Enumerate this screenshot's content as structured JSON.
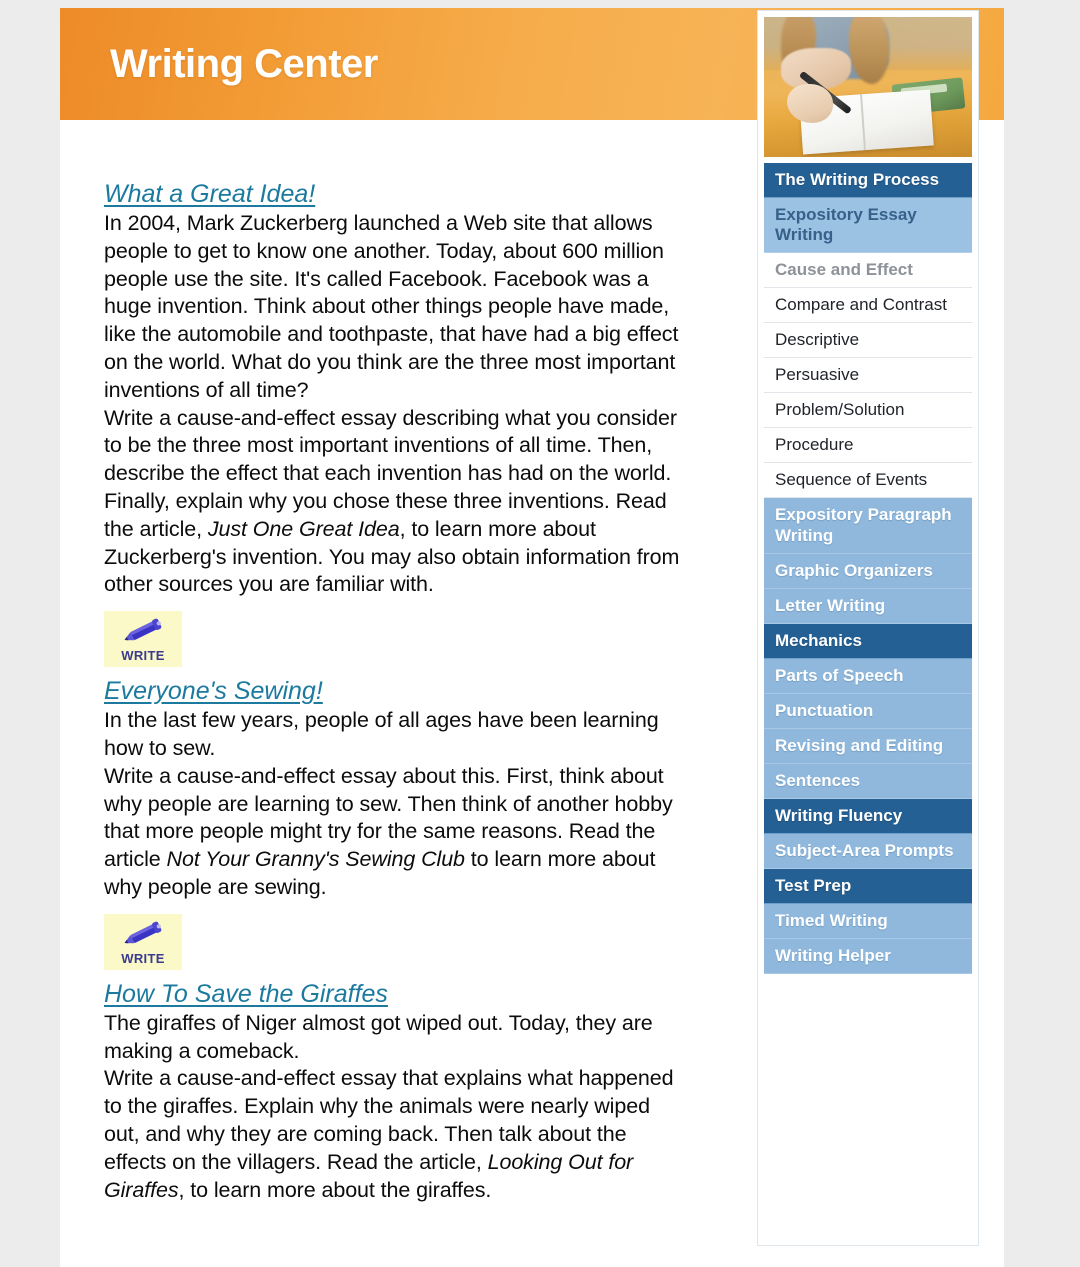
{
  "banner": {
    "title": "Writing Center"
  },
  "sidebar": {
    "photo_alt": "girl-writing-in-notebook-photo",
    "items": [
      {
        "label": "The Writing Process",
        "style": "dark"
      },
      {
        "label": "Expository Essay Writing",
        "style": "active-sub"
      },
      {
        "label": "Cause and Effect",
        "style": "current"
      },
      {
        "label": "Compare and Contrast",
        "style": "plain"
      },
      {
        "label": "Descriptive",
        "style": "plain"
      },
      {
        "label": "Persuasive",
        "style": "plain"
      },
      {
        "label": "Problem/Solution",
        "style": "plain"
      },
      {
        "label": "Procedure",
        "style": "plain"
      },
      {
        "label": "Sequence of Events",
        "style": "plain"
      },
      {
        "label": "Expository Paragraph Writing",
        "style": "light"
      },
      {
        "label": "Graphic Organizers",
        "style": "light"
      },
      {
        "label": "Letter Writing",
        "style": "light"
      },
      {
        "label": "Mechanics",
        "style": "dark"
      },
      {
        "label": "Parts of Speech",
        "style": "light"
      },
      {
        "label": "Punctuation",
        "style": "light"
      },
      {
        "label": "Revising and Editing",
        "style": "light"
      },
      {
        "label": "Sentences",
        "style": "light"
      },
      {
        "label": "Writing Fluency",
        "style": "dark"
      },
      {
        "label": "Subject-Area Prompts",
        "style": "light"
      },
      {
        "label": "Test Prep",
        "style": "dark"
      },
      {
        "label": "Timed Writing",
        "style": "light"
      },
      {
        "label": "Writing Helper",
        "style": "light"
      }
    ]
  },
  "main": {
    "entries": [
      {
        "title": "What a Great Idea!",
        "intro": "In 2004, Mark Zuckerberg launched a Web site that allows people to get to know one another. Today, about 600 million people use the site. It's called Facebook. Facebook was a huge invention. Think about other things people have made, like the automobile and toothpaste, that have had a big effect on the world. What do you think are the three most important inventions of all time?",
        "prompt_pre": "Write a cause-and-effect essay describing what you consider to be the three most important inventions of all time. Then, describe the effect that each invention has had on the world. Finally, explain why you chose these three inventions. Read the article, ",
        "article": "Just One Great Idea",
        "prompt_post": ", to learn more about Zuckerberg's invention. You may also obtain information from other sources you are familiar with.",
        "has_write_button": true
      },
      {
        "title": "Everyone's Sewing!",
        "intro": "In the last few years, people of all ages have been learning how to sew.",
        "prompt_pre": "Write a cause-and-effect essay about this. First, think about why people are learning to sew. Then think of another hobby that more people might try for the same reasons. Read the article ",
        "article": "Not Your Granny's Sewing Club",
        "prompt_post": " to learn more about why people are sewing.",
        "has_write_button": true
      },
      {
        "title": "How To Save the Giraffes",
        "intro": "The giraffes of Niger almost got wiped out. Today, they are making a comeback.",
        "prompt_pre": "Write a cause-and-effect essay that explains what happened to the giraffes. Explain why the animals were nearly wiped out, and why they are coming back. Then talk about the effects on the villagers. Read the article, ",
        "article": "Looking Out for Giraffes",
        "prompt_post": ", to learn more about the giraffes.",
        "has_write_button": false
      }
    ],
    "write_button_label": "WRITE"
  },
  "colors": {
    "banner_orange": "#f2a03a",
    "link_teal": "#1b7a9e",
    "nav_dark_blue": "#256094",
    "nav_light_blue": "#8fb8dc",
    "write_button_yellow": "#fbf9c7",
    "pencil_blue": "#3a3ac0",
    "page_background": "#ececec"
  }
}
